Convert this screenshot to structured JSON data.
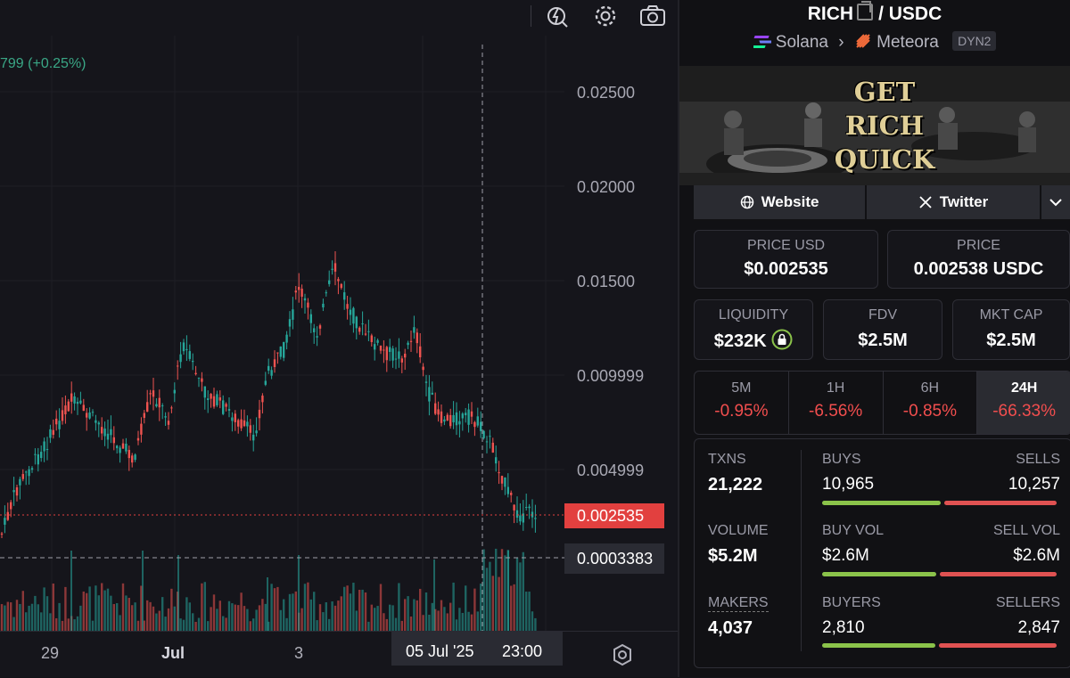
{
  "chart": {
    "change_text": "799 (+0.25%)",
    "price_axis": [
      "0.02500",
      "0.02000",
      "0.01500",
      "0.009999",
      "0.004999"
    ],
    "current_price_tag": "0.002535",
    "crosshair_price_tag": "0.0003383",
    "time_axis": [
      "29",
      "Jul",
      "3"
    ],
    "crosshair_date": "05 Jul '25",
    "crosshair_time": "23:00",
    "up_color": "#26a69a",
    "down_color": "#ef5350"
  },
  "toolbar": {
    "icons": [
      "alert-icon",
      "settings-gear-icon",
      "camera-icon"
    ]
  },
  "pair": {
    "base": "RICH",
    "quote": "/ USDC",
    "chain": "Solana",
    "dex": "Meteora",
    "pool_badge": "DYN2"
  },
  "banner": {
    "lines": [
      "GET",
      "RICH",
      "QUICK"
    ]
  },
  "links": {
    "website": "Website",
    "twitter": "Twitter"
  },
  "prices": {
    "usd_label": "PRICE USD",
    "usd_value": "$0.002535",
    "native_label": "PRICE",
    "native_value": "0.002538 USDC"
  },
  "metrics": {
    "liquidity_label": "LIQUIDITY",
    "liquidity_value": "$232K",
    "fdv_label": "FDV",
    "fdv_value": "$2.5M",
    "mktcap_label": "MKT CAP",
    "mktcap_value": "$2.5M"
  },
  "timeframes": [
    {
      "label": "5M",
      "value": "-0.95%"
    },
    {
      "label": "1H",
      "value": "-6.56%"
    },
    {
      "label": "6H",
      "value": "-0.85%"
    },
    {
      "label": "24H",
      "value": "-66.33%"
    }
  ],
  "stats": {
    "txns_label": "TXNS",
    "txns_value": "21,222",
    "buys_label": "BUYS",
    "buys_value": "10,965",
    "sells_label": "SELLS",
    "sells_value": "10,257",
    "volume_label": "VOLUME",
    "volume_value": "$5.2M",
    "buyvol_label": "BUY VOL",
    "buyvol_value": "$2.6M",
    "sellvol_label": "SELL VOL",
    "sellvol_value": "$2.6M",
    "makers_label": "MAKERS",
    "makers_value": "4,037",
    "buyers_label": "BUYERS",
    "buyers_value": "2,810",
    "sellers_label": "SELLERS",
    "sellers_value": "2,847"
  }
}
